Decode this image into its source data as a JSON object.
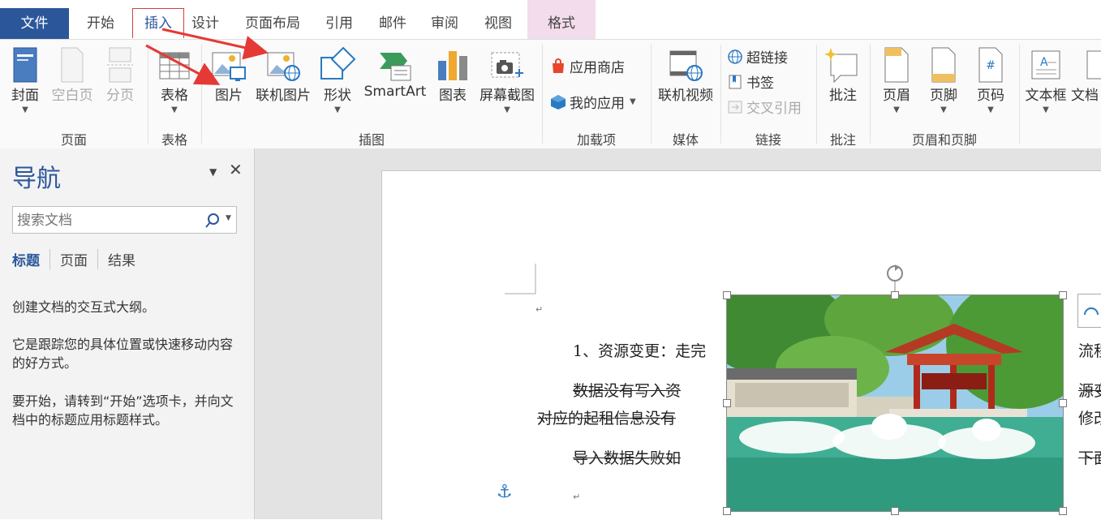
{
  "ribbon_tabs": {
    "file": "文件",
    "home": "开始",
    "insert": "插入",
    "design": "设计",
    "layout": "页面布局",
    "references": "引用",
    "mailings": "邮件",
    "review": "审阅",
    "view": "视图",
    "format": "格式"
  },
  "ribbon": {
    "pages": {
      "cover": "封面",
      "blank": "空白页",
      "break": "分页",
      "group": "页面"
    },
    "tables": {
      "table": "表格",
      "group": "表格"
    },
    "illustrations": {
      "picture": "图片",
      "online_picture": "联机图片",
      "shapes": "形状",
      "smartart": "SmartArt",
      "chart": "图表",
      "screenshot": "屏幕截图",
      "group": "插图"
    },
    "addins": {
      "store": "应用商店",
      "my_apps": "我的应用",
      "group": "加载项"
    },
    "media": {
      "online_video": "联机视频",
      "group": "媒体"
    },
    "links": {
      "hyperlink": "超链接",
      "bookmark": "书签",
      "cross_ref": "交叉引用",
      "group": "链接"
    },
    "comments": {
      "comment": "批注",
      "group": "批注"
    },
    "header_footer": {
      "header": "页眉",
      "footer": "页脚",
      "page_number": "页码",
      "group": "页眉和页脚"
    },
    "text": {
      "textbox": "文本框",
      "docparts": "文档"
    }
  },
  "nav": {
    "title": "导航",
    "search_placeholder": "搜索文档",
    "tabs": [
      "标题",
      "页面",
      "结果"
    ],
    "line1": "创建文档的交互式大纲。",
    "line2": "它是跟踪您的具体位置或快速移动内容的好方式。",
    "line3": "要开始，请转到“开始”选项卡，并向文档中的标题应用标题样式。"
  },
  "document": {
    "p1": "1、资源变更：走完",
    "p2": "数据没有写入资",
    "p3": "对应的起租信息没有",
    "p4": "导入数据失败如",
    "r1": "流程",
    "r2": "源变",
    "r3": "修改",
    "r4": "下面"
  },
  "colors": {
    "accent": "#2b579a",
    "annotation_arrow": "#e53935",
    "context_tab": "#f3dceb"
  }
}
